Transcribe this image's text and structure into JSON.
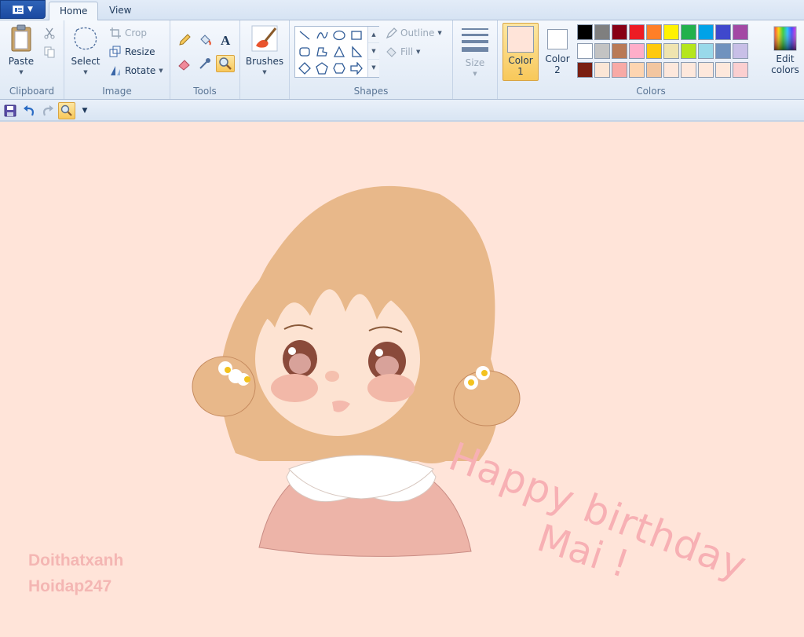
{
  "tabs": [
    {
      "label": "Home",
      "active": true
    },
    {
      "label": "View",
      "active": false
    }
  ],
  "clipboard": {
    "paste": "Paste",
    "group": "Clipboard"
  },
  "image": {
    "select": "Select",
    "crop": "Crop",
    "resize": "Resize",
    "rotate": "Rotate",
    "group": "Image"
  },
  "tools": {
    "group": "Tools"
  },
  "brushes": {
    "label": "Brushes"
  },
  "shapes": {
    "outline": "Outline",
    "fill": "Fill",
    "group": "Shapes"
  },
  "size": {
    "label": "Size"
  },
  "colors": {
    "color1_line1": "Color",
    "color1_line2": "1",
    "color2_line1": "Color",
    "color2_line2": "2",
    "color1_value": "#ffe4d9",
    "color2_value": "#ffffff",
    "edit_line1": "Edit",
    "edit_line2": "colors",
    "group": "Colors",
    "palette_row1": [
      "#000000",
      "#7f7f7f",
      "#880015",
      "#ed1c24",
      "#ff7f27",
      "#fff200",
      "#22b14c",
      "#00a2e8",
      "#3f48cc",
      "#a349a4"
    ],
    "palette_row2": [
      "#ffffff",
      "#c3c3c3",
      "#b97a57",
      "#ffaec9",
      "#ffc90e",
      "#efe4b0",
      "#b5e61d",
      "#99d9ea",
      "#7092be",
      "#c8bfe7"
    ],
    "palette_row3": [
      "#7a1f12",
      "#fbe6d6",
      "#f8aaa6",
      "#fdd5b1",
      "#f2c6a0",
      "#fde8dc",
      "#fde8dc",
      "#fde8dc",
      "#fde8dc",
      "#fbcfd0"
    ]
  },
  "canvas": {
    "text_line1": "Happy birthday",
    "text_line2": "Mai !",
    "watermark1": "Doithatxanh",
    "watermark2": "Hoidap247"
  }
}
